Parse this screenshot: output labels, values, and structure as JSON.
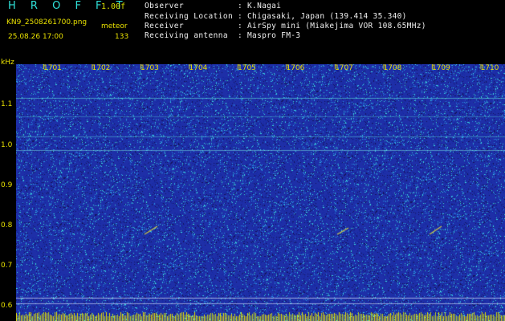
{
  "header": {
    "app_title": "H R O F F T",
    "version": "1.00f",
    "filename": "KN9_2508261700.png",
    "mode": "meteor",
    "datetime": "25.08.26 17:00",
    "count": "133"
  },
  "info": {
    "rows": [
      {
        "label": "Observer",
        "value": ": K.Nagai"
      },
      {
        "label": "Receiving Location",
        "value": ": Chigasaki, Japan (139.414 35.340)"
      },
      {
        "label": "Receiver",
        "value": ": AirSpy mini (Miakejima VOR 108.65MHz)"
      },
      {
        "label": "Receiving antenna",
        "value": ": Maspro FM-3"
      }
    ]
  },
  "chart_data": {
    "type": "heatmap",
    "ylabel": "kHz",
    "y_ticks": [
      "1.1",
      "1.0",
      "0.9",
      "0.8",
      "0.7",
      "0.6"
    ],
    "x_ticks": [
      "1701",
      "1702",
      "1703",
      "1704",
      "1705",
      "1706",
      "1707",
      "1708",
      "1709",
      "1710"
    ],
    "colors": {
      "background": "#1e2fa8",
      "noise": "#2fe0d8",
      "signal": "#e8e000",
      "meteor": "#ff6040"
    }
  }
}
